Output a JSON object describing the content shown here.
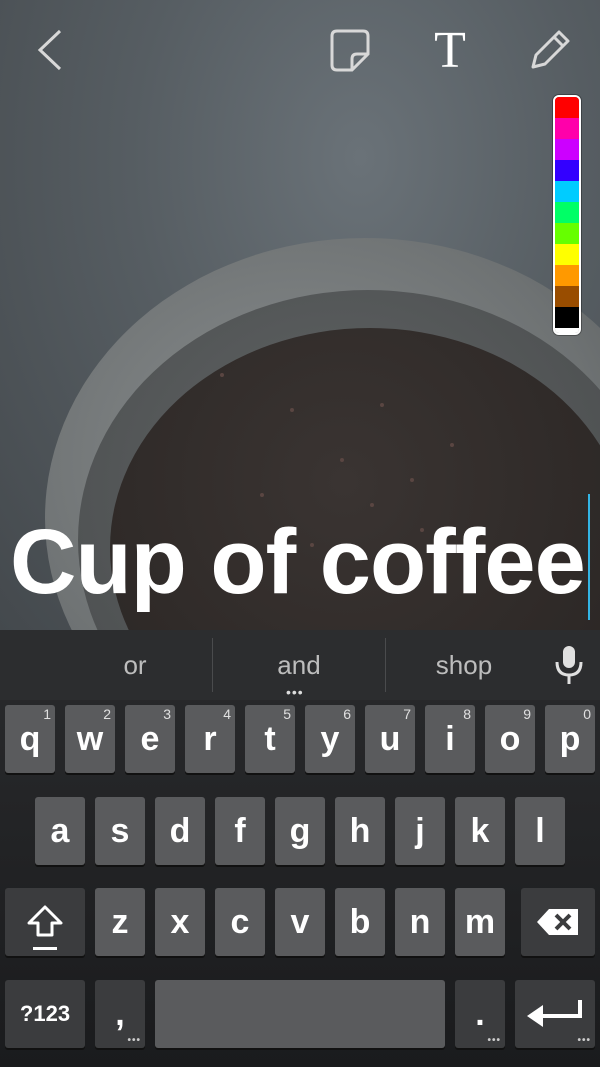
{
  "toolbar": {
    "back_icon": "chevron-left-icon",
    "sticker_icon": "sticker-icon",
    "text_tool_label": "T",
    "pencil_icon": "pencil-icon"
  },
  "palette": {
    "colors": [
      "#ff0000",
      "#ff00aa",
      "#cc00ff",
      "#3300ff",
      "#00ccff",
      "#00ff66",
      "#66ff00",
      "#ffff00",
      "#ff9900",
      "#994d00",
      "#000000",
      "#ffffff"
    ]
  },
  "caption": {
    "text": "Cup of coffee"
  },
  "keyboard": {
    "suggestions": [
      "or",
      "and",
      "shop"
    ],
    "row1": [
      {
        "key": "q",
        "num": "1"
      },
      {
        "key": "w",
        "num": "2"
      },
      {
        "key": "e",
        "num": "3"
      },
      {
        "key": "r",
        "num": "4"
      },
      {
        "key": "t",
        "num": "5"
      },
      {
        "key": "y",
        "num": "6"
      },
      {
        "key": "u",
        "num": "7"
      },
      {
        "key": "i",
        "num": "8"
      },
      {
        "key": "o",
        "num": "9"
      },
      {
        "key": "p",
        "num": "0"
      }
    ],
    "row2": [
      "a",
      "s",
      "d",
      "f",
      "g",
      "h",
      "j",
      "k",
      "l"
    ],
    "row3": [
      "z",
      "x",
      "c",
      "v",
      "b",
      "n",
      "m"
    ],
    "symbols_label": "?123",
    "comma_label": ",",
    "period_label": "."
  }
}
